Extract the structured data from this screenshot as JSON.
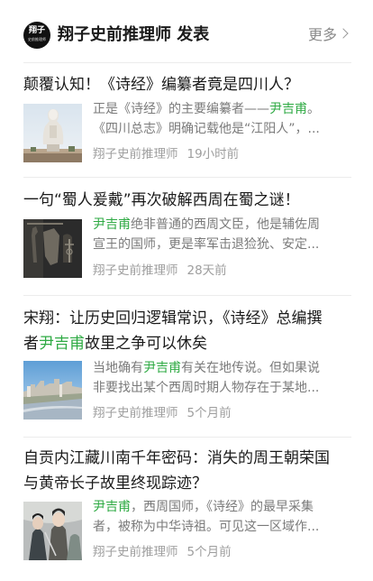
{
  "header": {
    "avatar_text_main": "翔子",
    "avatar_text_sub": "史前推理师",
    "title": "翔子史前推理师 发表",
    "more_label": "更多"
  },
  "articles": [
    {
      "title": "颠覆认知！《诗经》编纂者竟是四川人？",
      "title_highlight": "",
      "title_after": "",
      "summary_line1_pre": "正是《诗经》的主要编纂者——",
      "summary_line1_hl": "尹吉甫",
      "summary_line1_post": "。",
      "summary_line2": "《四川总志》明确记载他是“江阳人”，...",
      "author": "翔子史前推理师",
      "time": "19小时前",
      "thumb_icon": "statue-image"
    },
    {
      "title": "一句“蜀人爰戴”再次破解西周在蜀之谜！",
      "title_highlight": "",
      "title_after": "",
      "summary_line1_pre": "",
      "summary_line1_hl": "尹吉甫",
      "summary_line1_post": "绝非普通的西周文臣，他是辅佐周",
      "summary_line2": "宣王的国师，更是率军击退猃狁、安定...",
      "author": "翔子史前推理师",
      "time": "28天前",
      "thumb_icon": "bronze-artifact-image"
    },
    {
      "title": "宋翔：让历史回归逻辑常识，《诗经》总编撰",
      "title_line2_pre": "者",
      "title_highlight": "尹吉甫",
      "title_after": "故里之争可以休矣",
      "summary_line1_pre": "当地确有",
      "summary_line1_hl": "尹吉甫",
      "summary_line1_post": "有关在地传说。但如果说",
      "summary_line2": "非要找出某个西周时期人物存在于某地...",
      "author": "翔子史前推理师",
      "time": "5个月前",
      "thumb_icon": "city-river-image"
    },
    {
      "title": "自贡内江藏川南千年密码：消失的周王朝荣国",
      "title_line2_pre": "与黄帝长子故里终现踪迹？",
      "title_highlight": "",
      "title_after": "",
      "summary_line1_pre": "",
      "summary_line1_hl": "尹吉甫",
      "summary_line1_post": "，西周国师，《诗经》的最早采集",
      "summary_line2": "者，被称为中华诗祖。可见这一区域作...",
      "author": "翔子史前推理师",
      "time": "5个月前",
      "thumb_icon": "costume-figures-image"
    }
  ],
  "colors": {
    "highlight": "#2eaa43",
    "muted": "#7a7a7a",
    "meta": "#9e9e9e"
  }
}
